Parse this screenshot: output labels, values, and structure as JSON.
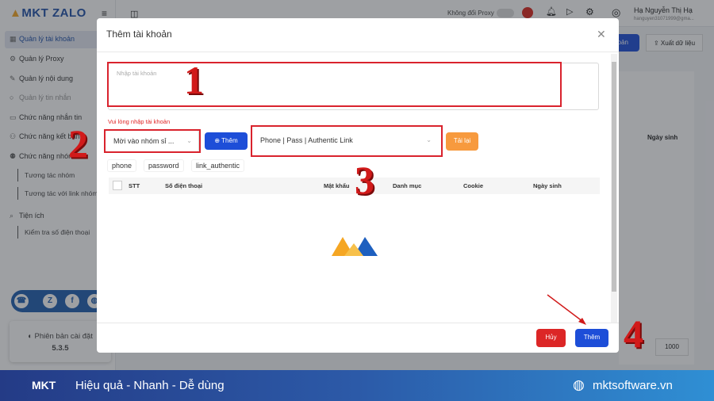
{
  "app": {
    "logo_text": "MKT ZALO",
    "sidebar": {
      "items": [
        {
          "label": "Quản lý tài khoản",
          "icon": "grid-icon"
        },
        {
          "label": "Quản lý Proxy",
          "icon": "proxy-icon"
        },
        {
          "label": "Quản lý nội dung",
          "icon": "content-icon"
        },
        {
          "label": "Quản lý tin nhắn",
          "icon": "message-icon"
        },
        {
          "label": "Chức năng nhắn tin",
          "icon": "chat-icon"
        },
        {
          "label": "Chức năng kết bạn",
          "icon": "add-friend-icon"
        },
        {
          "label": "Chức năng nhóm",
          "icon": "group-icon"
        }
      ],
      "group_sub": [
        "Tương tác nhóm",
        "Tương tác với link nhóm"
      ],
      "utilities": "Tiện ích",
      "utilities_sub": [
        "Kiểm tra số điện thoại"
      ],
      "version_label": "Phiên bản cài đặt",
      "version": "5.3.5"
    },
    "topbar": {
      "proxy_toggle": "Không đổi Proxy",
      "user_name": "Hạ Nguyễn Thị Hạ",
      "user_email": "hanguyen31071999@gma..."
    },
    "toolbar": {
      "add_partial": "hoản",
      "export": "Xuất dữ liệu"
    },
    "bg_table_header": "Ngày sinh",
    "page_size": "1000"
  },
  "modal": {
    "title": "Thêm tài khoản",
    "textarea_placeholder": "Nhập tài khoản",
    "error": "Vui lòng nhập tài khoản",
    "category_select": "Mời vào nhóm sỉ ...",
    "add_button": "Thêm",
    "format_select": "Phone | Pass | Authentic Link",
    "reload_button": "Tải lại",
    "tags": [
      "phone",
      "password",
      "link_authentic"
    ],
    "columns": [
      "STT",
      "Số điện thoại",
      "Mật khẩu",
      "Danh mục",
      "Cookie",
      "Ngày sinh"
    ],
    "cancel_button": "Hủy",
    "submit_button": "Thêm"
  },
  "annotations": [
    "1",
    "2",
    "3",
    "4"
  ],
  "banner": {
    "logo": "MKT",
    "slogan": "Hiệu quả - Nhanh - Dễ dùng",
    "website": "mktsoftware.vn"
  },
  "colors": {
    "primary": "#1d4ed8",
    "danger": "#dc2626",
    "warning": "#f79a3e",
    "annotation": "#d11a1a"
  }
}
